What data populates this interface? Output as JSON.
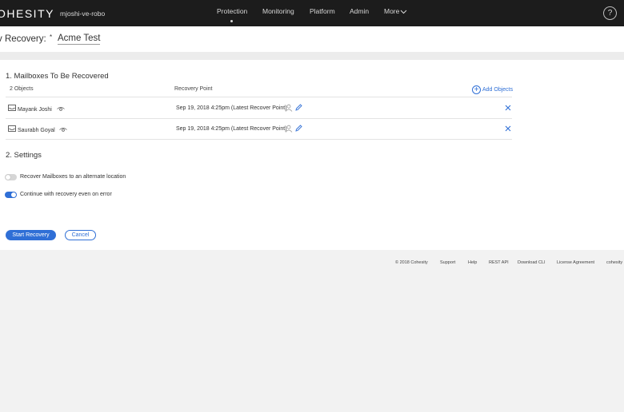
{
  "nav": {
    "logo": "OHESITY",
    "cluster": "mjoshi-ve-robo",
    "items": [
      "Protection",
      "Monitoring",
      "Platform",
      "Admin",
      "More"
    ],
    "help": "?"
  },
  "page": {
    "title": "v Recovery:",
    "required_mark": "*",
    "name": "Acme Test"
  },
  "mailboxes": {
    "section_title": "1. Mailboxes To Be Recovered",
    "count_label": "2 Objects",
    "col_recovery_point": "Recovery Point",
    "add_objects": "Add Objects",
    "rows": [
      {
        "name": "Mayank Joshi",
        "recovery_point": "Sep 19, 2018 4:25pm (Latest Recover Point)"
      },
      {
        "name": "Saurabh Goyal",
        "recovery_point": "Sep 19, 2018 4:25pm (Latest Recover Point)"
      }
    ]
  },
  "settings": {
    "section_title": "2. Settings",
    "options": [
      {
        "label": "Recover Mailboxes to an alternate location",
        "enabled": false
      },
      {
        "label": "Continue with recovery even on error",
        "enabled": true
      }
    ]
  },
  "actions": {
    "start": "Start Recovery",
    "cancel": "Cancel"
  },
  "footer": {
    "items": [
      "© 2018 Cohesity",
      "Support",
      "Help",
      "REST API",
      "Download CLI",
      "License Agreement",
      "cohesity"
    ]
  },
  "colors": {
    "nav_bg": "#1c1c1c",
    "accent": "#2f6fd6"
  }
}
